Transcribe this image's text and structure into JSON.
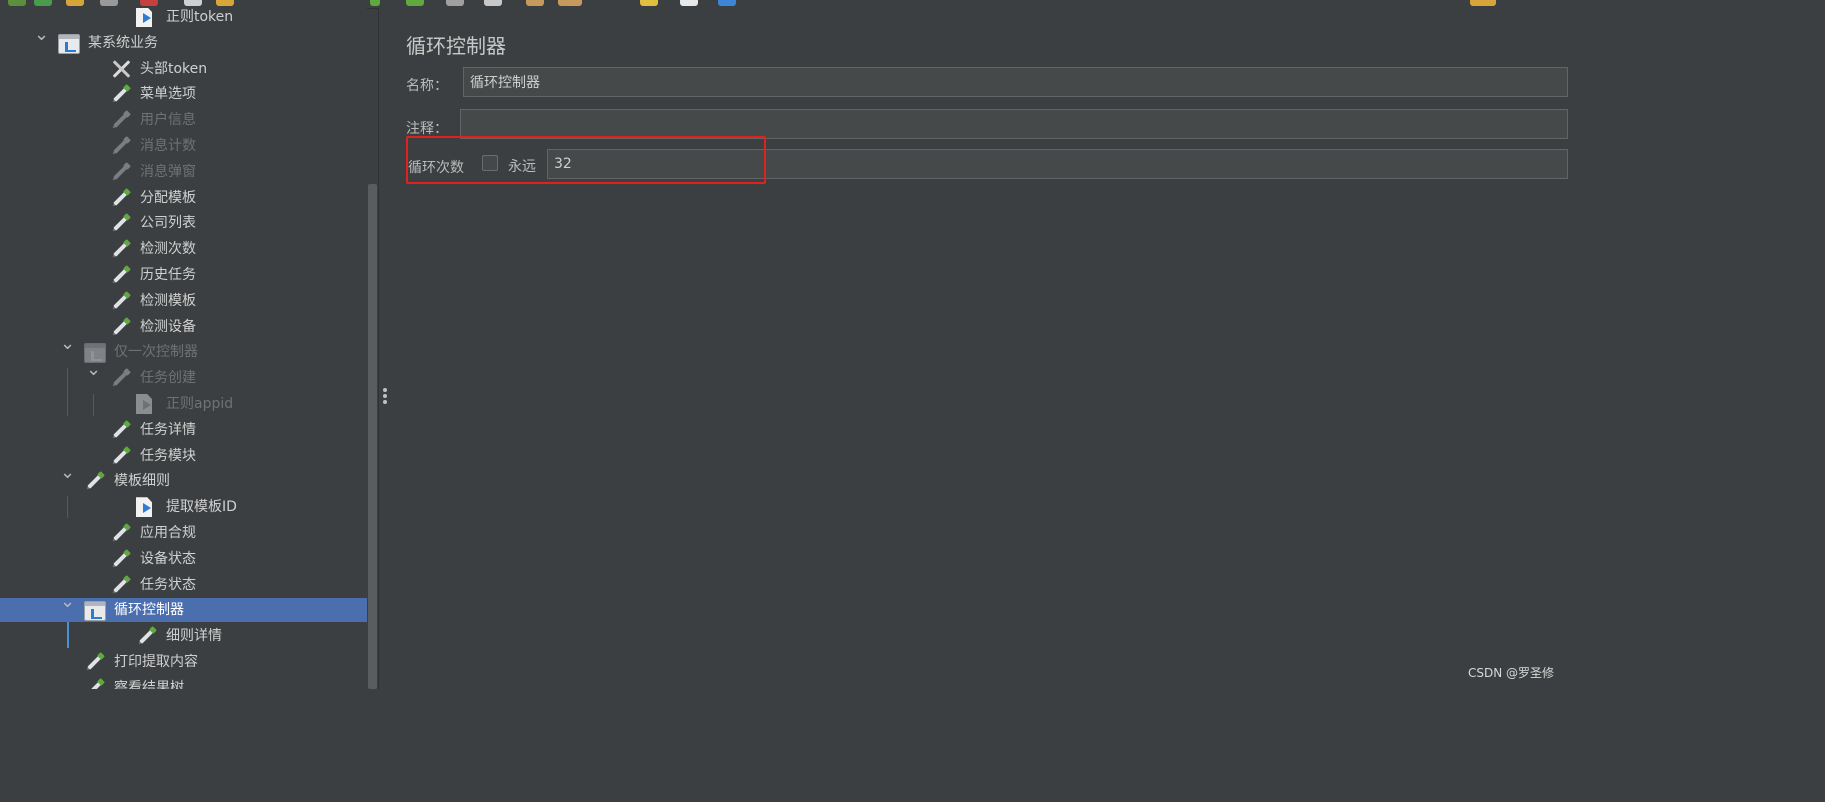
{
  "tree": {
    "items": [
      {
        "label": "正则token",
        "icon": "regex-extractor-icon",
        "disabled": false,
        "chevron": ""
      },
      {
        "label": "某系统业务",
        "icon": "controller-icon",
        "disabled": false,
        "chevron": "expanded"
      },
      {
        "label": "头部token",
        "icon": "header-manager-icon",
        "disabled": false,
        "chevron": ""
      },
      {
        "label": "菜单选项",
        "icon": "http-sampler-icon",
        "disabled": false,
        "chevron": ""
      },
      {
        "label": "用户信息",
        "icon": "http-sampler-icon",
        "disabled": true,
        "chevron": ""
      },
      {
        "label": "消息计数",
        "icon": "http-sampler-icon",
        "disabled": true,
        "chevron": ""
      },
      {
        "label": "消息弹窗",
        "icon": "http-sampler-icon",
        "disabled": true,
        "chevron": ""
      },
      {
        "label": "分配模板",
        "icon": "http-sampler-icon",
        "disabled": false,
        "chevron": ""
      },
      {
        "label": "公司列表",
        "icon": "http-sampler-icon",
        "disabled": false,
        "chevron": ""
      },
      {
        "label": "检测次数",
        "icon": "http-sampler-icon",
        "disabled": false,
        "chevron": ""
      },
      {
        "label": "历史任务",
        "icon": "http-sampler-icon",
        "disabled": false,
        "chevron": ""
      },
      {
        "label": "检测模板",
        "icon": "http-sampler-icon",
        "disabled": false,
        "chevron": ""
      },
      {
        "label": "检测设备",
        "icon": "http-sampler-icon",
        "disabled": false,
        "chevron": ""
      },
      {
        "label": "仅一次控制器",
        "icon": "controller-icon",
        "disabled": true,
        "chevron": "expanded"
      },
      {
        "label": "任务创建",
        "icon": "http-sampler-icon",
        "disabled": true,
        "chevron": "expanded"
      },
      {
        "label": "正则appid",
        "icon": "regex-extractor-icon",
        "disabled": true,
        "chevron": ""
      },
      {
        "label": "任务详情",
        "icon": "http-sampler-icon",
        "disabled": false,
        "chevron": ""
      },
      {
        "label": "任务模块",
        "icon": "http-sampler-icon",
        "disabled": false,
        "chevron": ""
      },
      {
        "label": "模板细则",
        "icon": "http-sampler-icon",
        "disabled": false,
        "chevron": "expanded"
      },
      {
        "label": "提取模板ID",
        "icon": "regex-extractor-icon",
        "disabled": false,
        "chevron": ""
      },
      {
        "label": "应用合规",
        "icon": "http-sampler-icon",
        "disabled": false,
        "chevron": ""
      },
      {
        "label": "设备状态",
        "icon": "http-sampler-icon",
        "disabled": false,
        "chevron": ""
      },
      {
        "label": "任务状态",
        "icon": "http-sampler-icon",
        "disabled": false,
        "chevron": ""
      },
      {
        "label": "循环控制器",
        "icon": "controller-icon",
        "disabled": false,
        "chevron": "expanded",
        "selected": true
      },
      {
        "label": "细则详情",
        "icon": "http-sampler-icon",
        "disabled": false,
        "chevron": ""
      },
      {
        "label": "打印提取内容",
        "icon": "http-sampler-icon",
        "disabled": false,
        "chevron": ""
      },
      {
        "label": "察看结果树",
        "icon": "listener-icon",
        "disabled": false,
        "chevron": ""
      }
    ]
  },
  "panel": {
    "title": "循环控制器",
    "name_label": "名称：",
    "name_value": "循环控制器",
    "comment_label": "注释：",
    "comment_value": "",
    "loop_count_label": "循环次数",
    "forever_label": "永远",
    "forever_checked": false,
    "loop_count_value": "32"
  },
  "colors": {
    "background": "#3c3f41",
    "selection": "#4b6eaf",
    "highlight_box": "#e0221d"
  },
  "watermark": "CSDN @罗圣修"
}
